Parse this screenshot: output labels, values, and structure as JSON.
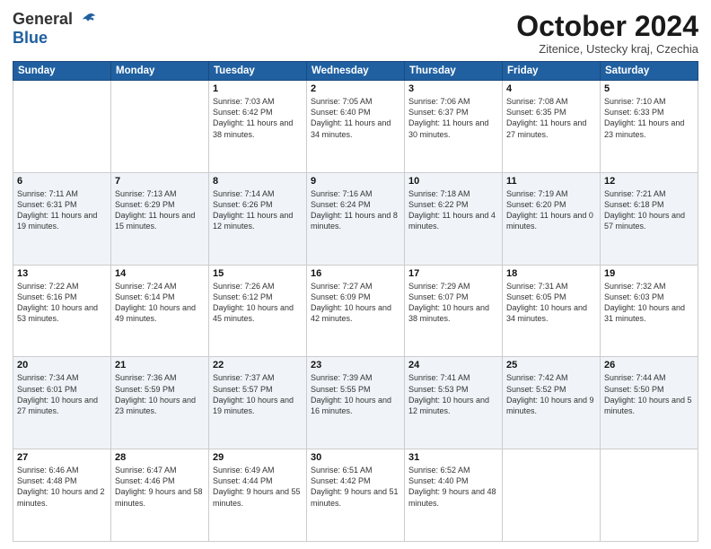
{
  "header": {
    "logo_line1": "General",
    "logo_line2": "Blue",
    "month": "October 2024",
    "location": "Zitenice, Ustecky kraj, Czechia"
  },
  "weekdays": [
    "Sunday",
    "Monday",
    "Tuesday",
    "Wednesday",
    "Thursday",
    "Friday",
    "Saturday"
  ],
  "weeks": [
    [
      null,
      null,
      {
        "day": 1,
        "sunrise": "7:03 AM",
        "sunset": "6:42 PM",
        "daylight": "11 hours and 38 minutes."
      },
      {
        "day": 2,
        "sunrise": "7:05 AM",
        "sunset": "6:40 PM",
        "daylight": "11 hours and 34 minutes."
      },
      {
        "day": 3,
        "sunrise": "7:06 AM",
        "sunset": "6:37 PM",
        "daylight": "11 hours and 30 minutes."
      },
      {
        "day": 4,
        "sunrise": "7:08 AM",
        "sunset": "6:35 PM",
        "daylight": "11 hours and 27 minutes."
      },
      {
        "day": 5,
        "sunrise": "7:10 AM",
        "sunset": "6:33 PM",
        "daylight": "11 hours and 23 minutes."
      }
    ],
    [
      {
        "day": 6,
        "sunrise": "7:11 AM",
        "sunset": "6:31 PM",
        "daylight": "11 hours and 19 minutes."
      },
      {
        "day": 7,
        "sunrise": "7:13 AM",
        "sunset": "6:29 PM",
        "daylight": "11 hours and 15 minutes."
      },
      {
        "day": 8,
        "sunrise": "7:14 AM",
        "sunset": "6:26 PM",
        "daylight": "11 hours and 12 minutes."
      },
      {
        "day": 9,
        "sunrise": "7:16 AM",
        "sunset": "6:24 PM",
        "daylight": "11 hours and 8 minutes."
      },
      {
        "day": 10,
        "sunrise": "7:18 AM",
        "sunset": "6:22 PM",
        "daylight": "11 hours and 4 minutes."
      },
      {
        "day": 11,
        "sunrise": "7:19 AM",
        "sunset": "6:20 PM",
        "daylight": "11 hours and 0 minutes."
      },
      {
        "day": 12,
        "sunrise": "7:21 AM",
        "sunset": "6:18 PM",
        "daylight": "10 hours and 57 minutes."
      }
    ],
    [
      {
        "day": 13,
        "sunrise": "7:22 AM",
        "sunset": "6:16 PM",
        "daylight": "10 hours and 53 minutes."
      },
      {
        "day": 14,
        "sunrise": "7:24 AM",
        "sunset": "6:14 PM",
        "daylight": "10 hours and 49 minutes."
      },
      {
        "day": 15,
        "sunrise": "7:26 AM",
        "sunset": "6:12 PM",
        "daylight": "10 hours and 45 minutes."
      },
      {
        "day": 16,
        "sunrise": "7:27 AM",
        "sunset": "6:09 PM",
        "daylight": "10 hours and 42 minutes."
      },
      {
        "day": 17,
        "sunrise": "7:29 AM",
        "sunset": "6:07 PM",
        "daylight": "10 hours and 38 minutes."
      },
      {
        "day": 18,
        "sunrise": "7:31 AM",
        "sunset": "6:05 PM",
        "daylight": "10 hours and 34 minutes."
      },
      {
        "day": 19,
        "sunrise": "7:32 AM",
        "sunset": "6:03 PM",
        "daylight": "10 hours and 31 minutes."
      }
    ],
    [
      {
        "day": 20,
        "sunrise": "7:34 AM",
        "sunset": "6:01 PM",
        "daylight": "10 hours and 27 minutes."
      },
      {
        "day": 21,
        "sunrise": "7:36 AM",
        "sunset": "5:59 PM",
        "daylight": "10 hours and 23 minutes."
      },
      {
        "day": 22,
        "sunrise": "7:37 AM",
        "sunset": "5:57 PM",
        "daylight": "10 hours and 19 minutes."
      },
      {
        "day": 23,
        "sunrise": "7:39 AM",
        "sunset": "5:55 PM",
        "daylight": "10 hours and 16 minutes."
      },
      {
        "day": 24,
        "sunrise": "7:41 AM",
        "sunset": "5:53 PM",
        "daylight": "10 hours and 12 minutes."
      },
      {
        "day": 25,
        "sunrise": "7:42 AM",
        "sunset": "5:52 PM",
        "daylight": "10 hours and 9 minutes."
      },
      {
        "day": 26,
        "sunrise": "7:44 AM",
        "sunset": "5:50 PM",
        "daylight": "10 hours and 5 minutes."
      }
    ],
    [
      {
        "day": 27,
        "sunrise": "6:46 AM",
        "sunset": "4:48 PM",
        "daylight": "10 hours and 2 minutes."
      },
      {
        "day": 28,
        "sunrise": "6:47 AM",
        "sunset": "4:46 PM",
        "daylight": "9 hours and 58 minutes."
      },
      {
        "day": 29,
        "sunrise": "6:49 AM",
        "sunset": "4:44 PM",
        "daylight": "9 hours and 55 minutes."
      },
      {
        "day": 30,
        "sunrise": "6:51 AM",
        "sunset": "4:42 PM",
        "daylight": "9 hours and 51 minutes."
      },
      {
        "day": 31,
        "sunrise": "6:52 AM",
        "sunset": "4:40 PM",
        "daylight": "9 hours and 48 minutes."
      },
      null,
      null
    ]
  ]
}
